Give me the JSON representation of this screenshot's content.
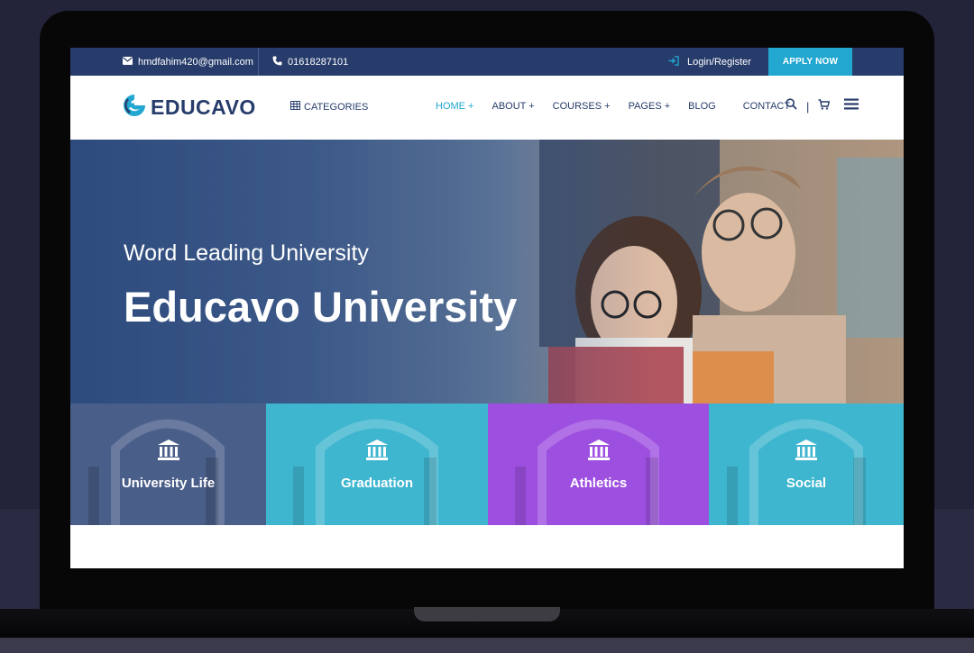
{
  "topbar": {
    "email": "hmdfahim420@gmail.com",
    "phone": "01618287101",
    "login": "Login/Register",
    "apply": "APPLY NOW"
  },
  "header": {
    "logo_text": "EDUCAVO",
    "categories": "CATEGORIES",
    "nav": [
      "HOME +",
      "ABOUT +",
      "COURSES +",
      "PAGES +",
      "BLOG",
      "CONTACT"
    ],
    "divider": "|"
  },
  "hero": {
    "subtitle": "Word Leading University",
    "title": "Educavo University"
  },
  "categories": [
    {
      "label": "University Life",
      "color": "#4a5e8a"
    },
    {
      "label": "Graduation",
      "color": "#3fb6cf"
    },
    {
      "label": "Athletics",
      "color": "#9d4fe0"
    },
    {
      "label": "Social",
      "color": "#3fb6cf"
    }
  ],
  "colors": {
    "accent": "#21a7d0",
    "navy": "#273c6b"
  },
  "icons": [
    "mail-icon",
    "phone-icon",
    "login-icon",
    "grid-icon",
    "search-icon",
    "cart-icon",
    "hamburger-icon",
    "institution-icon"
  ]
}
